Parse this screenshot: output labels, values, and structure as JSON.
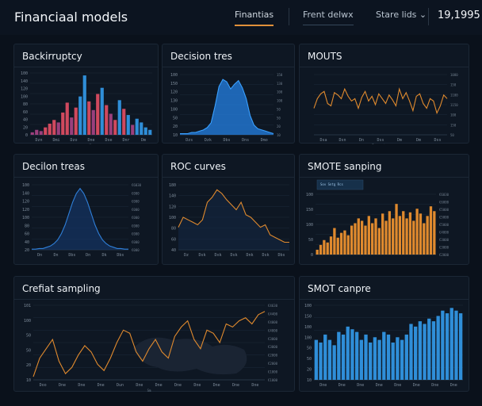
{
  "app": {
    "title": "Financiaal models",
    "tabs": [
      "Finantias",
      "Frent delwx"
    ],
    "share_label": "Stare lids",
    "counter": "19,1995"
  },
  "colors": {
    "background": "#0a111b",
    "panel": "#0e1723",
    "accent_orange": "#e08a2e",
    "bar_blue": "#2f8ed8",
    "bar_red": "#d0495e",
    "bar_magenta": "#9b3f7c"
  },
  "panels": [
    {
      "title": "Backirruptcy"
    },
    {
      "title": "Decision tres"
    },
    {
      "title": "MOUTS"
    },
    {
      "title": "Decilon treas"
    },
    {
      "title": "ROC curves"
    },
    {
      "title": "SMOTE sanping"
    },
    {
      "title": "Crefiat sampling"
    },
    {
      "title": "SMOT canpre"
    }
  ],
  "chart_data": [
    {
      "type": "bar",
      "title": "Backirruptcy",
      "values": [
        2,
        4,
        3,
        6,
        9,
        12,
        10,
        18,
        26,
        14,
        22,
        31,
        48,
        27,
        20,
        33,
        38,
        24,
        17,
        12,
        28,
        21,
        16,
        8,
        13,
        10,
        6,
        4
      ],
      "colors": [
        "#9b3f7c",
        "#9b3f7c",
        "#9b3f7c",
        "#d0495e",
        "#d0495e",
        "#d0495e",
        "#9b3f7c",
        "#d0495e",
        "#d0495e",
        "#9b3f7c",
        "#d0495e",
        "#2f8ed8",
        "#2f8ed8",
        "#d0495e",
        "#9b3f7c",
        "#d0495e",
        "#2f8ed8",
        "#d0495e",
        "#9b3f7c",
        "#d0495e",
        "#2f8ed8",
        "#d0495e",
        "#2f8ed8",
        "#9b3f7c",
        "#2f8ed8",
        "#2f8ed8",
        "#2f8ed8",
        "#2f8ed8"
      ],
      "ylim": [
        0,
        50
      ],
      "yticks": [
        "100",
        "140",
        "120",
        "100",
        "80",
        "60",
        "40",
        "20",
        "0"
      ],
      "xticks": [
        "Dzn",
        "Dmi",
        "Dzo",
        "Dne",
        "Dse",
        "Dnr",
        "Dm"
      ],
      "xlabel": "Ma"
    },
    {
      "type": "area",
      "title": "Decision tres",
      "values": [
        1,
        1,
        1,
        2,
        2,
        3,
        4,
        6,
        10,
        24,
        40,
        46,
        44,
        38,
        42,
        45,
        39,
        30,
        16,
        8,
        5,
        4,
        3,
        2,
        1
      ],
      "ylim": [
        0,
        50
      ],
      "yticks": [
        "100",
        "150",
        "120",
        "130",
        "100",
        "50",
        "20",
        "10"
      ],
      "yticks_right": [
        "150",
        "130",
        "100",
        "100",
        "50",
        "50",
        "20",
        "10"
      ],
      "xticks": [
        "Dzs",
        "Dzk",
        "Dbs",
        "Dns",
        "Dmo"
      ]
    },
    {
      "type": "line",
      "title": "MOUTS",
      "values": [
        22,
        30,
        34,
        36,
        26,
        24,
        35,
        33,
        30,
        38,
        32,
        28,
        30,
        22,
        31,
        36,
        28,
        32,
        25,
        34,
        30,
        26,
        33,
        29,
        24,
        38,
        30,
        35,
        28,
        20,
        32,
        34,
        26,
        22,
        30,
        28,
        18,
        24,
        33,
        30
      ],
      "ylim": [
        0,
        50
      ],
      "yticks_right": [
        "1080",
        "150",
        "1100",
        "1150",
        "100",
        "150",
        "50"
      ],
      "xticks": [
        "Dsa",
        "Dsn",
        "Dn",
        "Dss",
        "Dm",
        "Dm",
        "Dss"
      ],
      "xlabel": "Ferwestns"
    },
    {
      "type": "area",
      "title": "Decilon treas",
      "values": [
        0.5,
        0.5,
        1,
        1,
        2,
        3,
        5,
        8,
        13,
        20,
        29,
        38,
        45,
        49,
        45,
        38,
        29,
        20,
        13,
        8,
        5,
        3,
        2,
        1,
        1,
        0.5,
        0.5
      ],
      "ylim": [
        0,
        52
      ],
      "yticks": [
        "100",
        "140",
        "120",
        "120",
        "100",
        "80",
        "60",
        "40",
        "20"
      ],
      "yticks_right": [
        "€6030",
        "€000",
        "€000",
        "€000",
        "€000",
        "€000",
        "€000",
        "€000",
        "€000"
      ],
      "xticks": [
        "Dn",
        "Dn",
        "Dbs",
        "Dn",
        "Dk",
        "Dbs"
      ]
    },
    {
      "type": "line",
      "title": "ROC curves",
      "values": [
        18,
        26,
        24,
        22,
        20,
        24,
        38,
        42,
        48,
        45,
        40,
        36,
        32,
        38,
        28,
        26,
        22,
        18,
        20,
        12,
        10,
        8,
        6,
        6
      ],
      "ylim": [
        0,
        52
      ],
      "yticks": [
        "180",
        "140",
        "120",
        "100",
        "80",
        "60",
        "40"
      ],
      "xticks": [
        "Dz",
        "Dsk",
        "Dxk",
        "Dsk",
        "Dnk",
        "Dsk",
        "Dbs"
      ]
    },
    {
      "type": "bar",
      "title": "SMOTE sanping",
      "values": [
        4,
        8,
        12,
        10,
        15,
        22,
        14,
        18,
        20,
        16,
        24,
        26,
        30,
        28,
        24,
        32,
        26,
        30,
        22,
        34,
        28,
        36,
        30,
        42,
        32,
        36,
        30,
        35,
        28,
        38,
        34,
        26,
        32,
        40,
        36
      ],
      "ylim": [
        0,
        50
      ],
      "yticks": [
        "100",
        "150",
        "100",
        "50",
        "0"
      ],
      "yticks_right": [
        "€6030",
        "€6000",
        "€5000",
        "€5000",
        "€5000",
        "€4000",
        "€3000",
        "€3000",
        "€2000"
      ],
      "legend": "Sov Sntg Rcs"
    },
    {
      "type": "line",
      "title": "Crefiat sampling",
      "values": [
        2,
        14,
        20,
        26,
        12,
        4,
        8,
        16,
        22,
        18,
        10,
        6,
        14,
        24,
        32,
        30,
        18,
        12,
        20,
        26,
        18,
        14,
        28,
        34,
        38,
        26,
        20,
        32,
        30,
        24,
        36,
        34,
        38,
        40,
        36,
        42,
        44
      ],
      "ylim": [
        0,
        48
      ],
      "yticks": [
        "101",
        "100",
        "50",
        "50",
        "20",
        "10"
      ],
      "yticks_right": [
        "€4630",
        "€4400",
        "€4000",
        "€4000",
        "€3000",
        "€3000",
        "€2000",
        "€2000",
        "€1000",
        "€1000"
      ],
      "xticks": [
        "Doo",
        "Dne",
        "Dne",
        "Dne",
        "Dun",
        "Dne",
        "Dne",
        "Dne",
        "Dne",
        "Dne",
        "Dne",
        "Dne"
      ],
      "xlabel": "Sm"
    },
    {
      "type": "bar",
      "title": "SMOT canpre",
      "values": [
        30,
        28,
        34,
        30,
        26,
        36,
        34,
        40,
        38,
        36,
        30,
        34,
        28,
        32,
        30,
        36,
        34,
        28,
        32,
        30,
        34,
        42,
        40,
        44,
        42,
        46,
        44,
        48,
        52,
        50,
        54,
        52,
        50
      ],
      "ylim": [
        0,
        56
      ],
      "yticks": [
        "100",
        "150",
        "100",
        "100",
        "50",
        "50",
        "20",
        "10"
      ],
      "xticks": [
        "Dne",
        "Dne",
        "Dne",
        "Dne",
        "Dne",
        "Dne",
        "Dne",
        "Dne"
      ]
    }
  ]
}
